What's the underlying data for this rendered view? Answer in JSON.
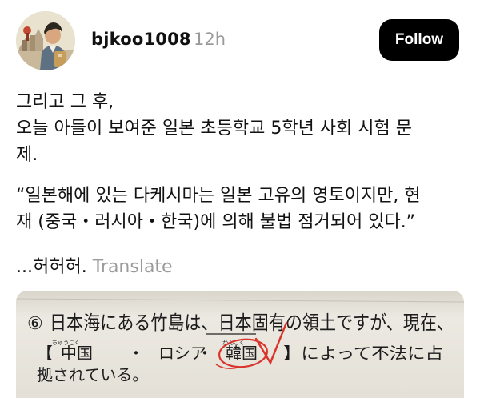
{
  "post": {
    "username": "bjkoo1008",
    "timestamp": "12h",
    "follow_label": "Follow",
    "text": {
      "line1": "그리고 그 후,",
      "line2": "오늘 아들이 보여준 일본 초등학교 5학년 사회 시험 문",
      "line3": "제.",
      "quote1": "“일본해에 있는 다케시마는 일본 고유의 영토이지만, 현",
      "quote2": "재 (중국・러시아・한국)에 의해 불법 점거되어 있다.”",
      "closing": "...허허허.",
      "translate_label": "Translate"
    }
  },
  "photo": {
    "question_number": "⑥",
    "line1": "日本海にある竹島は、日本固有の領土ですが、現在、",
    "bracket_open": "【",
    "option1": "中国",
    "option1_furigana": "ちゅうごく",
    "dot1": "・",
    "option2": "ロシア",
    "dot2": "・",
    "option3": "韓国",
    "option3_furigana": "かんこく",
    "bracket_close": "】によって不法に占",
    "line3": "拠されている。",
    "ink_color": "#d9342b"
  }
}
